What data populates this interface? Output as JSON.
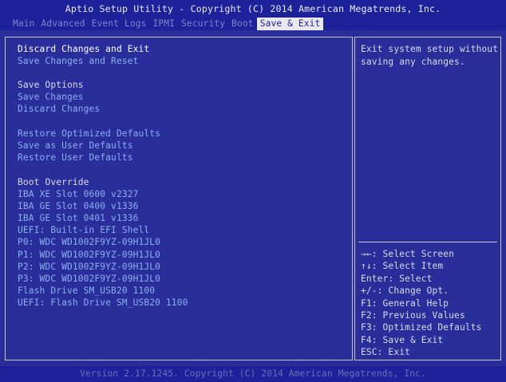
{
  "header": {
    "title": "Aptio Setup Utility - Copyright (C) 2014 American Megatrends, Inc.",
    "tabs": [
      "Main",
      "Advanced",
      "Event Logs",
      "IPMI",
      "Security",
      "Boot",
      "Save & Exit"
    ],
    "active_tab": "Save & Exit"
  },
  "menu": {
    "discard_and_exit": "Discard Changes and Exit",
    "save_and_reset": "Save Changes and Reset",
    "save_options_heading": "Save Options",
    "save_changes": "Save Changes",
    "discard_changes": "Discard Changes",
    "restore_optimized": "Restore Optimized Defaults",
    "save_user_defaults": "Save as User Defaults",
    "restore_user_defaults": "Restore User Defaults",
    "boot_override_heading": "Boot Override",
    "boot_items": [
      "IBA XE Slot 0600 v2327",
      "IBA GE Slot 0400 v1336",
      "IBA GE Slot 0401 v1336",
      "UEFI: Built-in EFI Shell",
      "P0: WDC WD1002F9YZ-09H1JL0",
      "P1: WDC WD1002F9YZ-09H1JL0",
      "P2: WDC WD1002F9YZ-09H1JL0",
      "P3: WDC WD1002F9YZ-09H1JL0",
      "Flash Drive SM_USB20 1100",
      "UEFI: Flash Drive SM_USB20 1100"
    ]
  },
  "help": {
    "description_lines": [
      "Exit system setup without",
      "saving any changes."
    ],
    "keys": [
      "→←: Select Screen",
      "↑↓: Select Item",
      "Enter: Select",
      "+/-: Change Opt.",
      "F1: General Help",
      "F2: Previous Values",
      "F3: Optimized Defaults",
      "F4: Save & Exit",
      "ESC: Exit"
    ]
  },
  "footer": {
    "version": "Version 2.17.1245. Copyright (C) 2014 American Megatrends, Inc."
  }
}
